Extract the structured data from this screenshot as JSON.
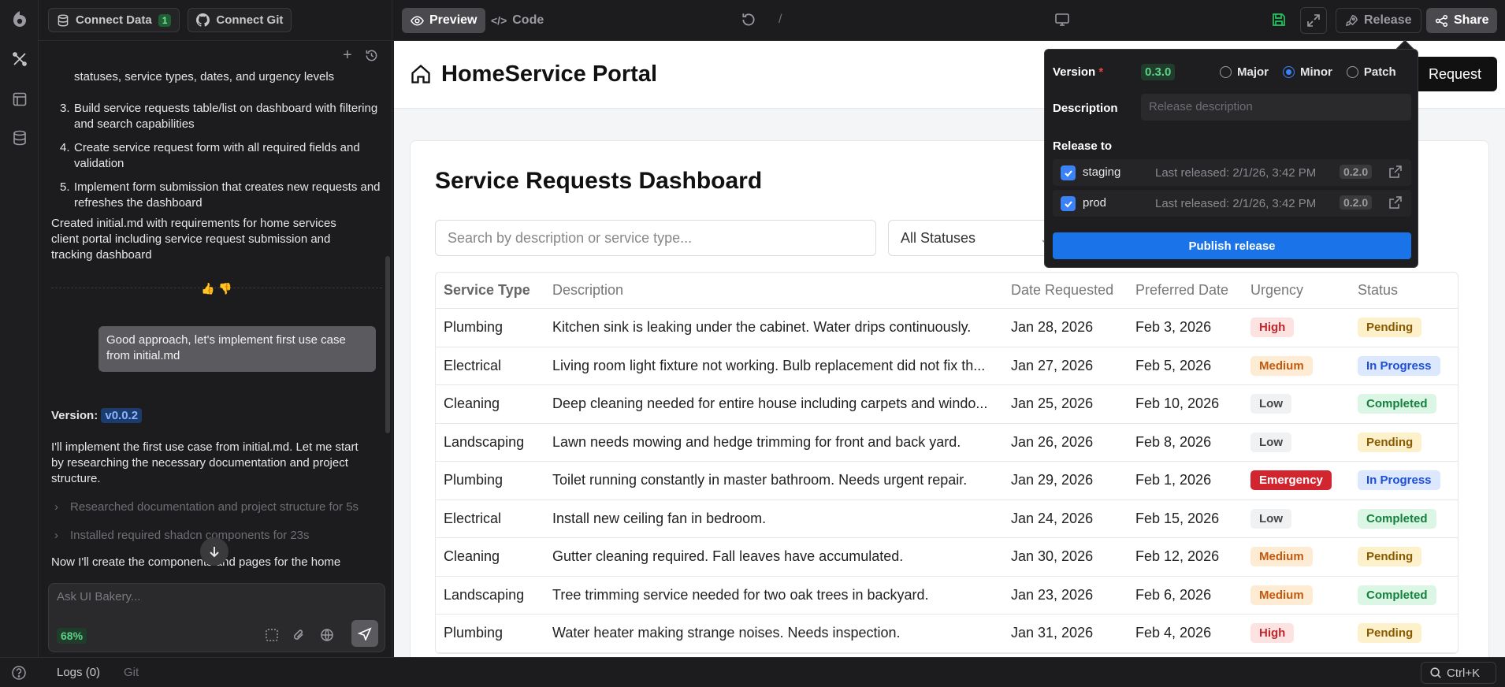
{
  "topbar": {
    "connect_data": "Connect Data",
    "connect_data_count": "1",
    "connect_git": "Connect Git",
    "preview_tab": "Preview",
    "code_tab": "Code",
    "path": "/",
    "release": "Release",
    "share": "Share"
  },
  "chat": {
    "steps": [
      {
        "num": "",
        "text": "statuses, service types, dates, and urgency levels"
      },
      {
        "num": "3.",
        "text": "Build service requests table/list on dashboard with filtering and search capabilities"
      },
      {
        "num": "4.",
        "text": "Create service request form with all required fields and validation"
      },
      {
        "num": "5.",
        "text": "Implement form submission that creates new requests and refreshes the dashboard"
      }
    ],
    "created_msg": "Created initial.md with requirements for home services client portal including service request submission and tracking dashboard",
    "user_msg": "Good approach, let's implement first use case from initial.md",
    "version_label": "Version:",
    "version_value": "v0.0.2",
    "implement_msg": "I'll implement the first use case from initial.md. Let me start by researching the necessary documentation and project structure.",
    "researched": "Researched documentation and project structure for 5s",
    "installed": "Installed required shadcn components for 23s",
    "now_msg": "Now I'll create the components and pages for the home",
    "input_placeholder": "Ask UI Bakery...",
    "context_percent": "68%"
  },
  "bottombar": {
    "logs": "Logs (0)",
    "git": "Git",
    "shortcut": "Ctrl+K"
  },
  "app": {
    "title": "HomeService Portal",
    "new_request": "Request",
    "dashboard_title": "Service Requests Dashboard",
    "search_placeholder": "Search by description or service type...",
    "status_filter": "All Statuses",
    "columns": [
      "Service Type",
      "Description",
      "Date Requested",
      "Preferred Date",
      "Urgency",
      "Status"
    ],
    "rows": [
      {
        "type": "Plumbing",
        "desc": "Kitchen sink is leaking under the cabinet. Water drips continuously.",
        "requested": "Jan 28, 2026",
        "preferred": "Feb 3, 2026",
        "urgency": "High",
        "status": "Pending"
      },
      {
        "type": "Electrical",
        "desc": "Living room light fixture not working. Bulb replacement did not fix th...",
        "requested": "Jan 27, 2026",
        "preferred": "Feb 5, 2026",
        "urgency": "Medium",
        "status": "In Progress"
      },
      {
        "type": "Cleaning",
        "desc": "Deep cleaning needed for entire house including carpets and windo...",
        "requested": "Jan 25, 2026",
        "preferred": "Feb 10, 2026",
        "urgency": "Low",
        "status": "Completed"
      },
      {
        "type": "Landscaping",
        "desc": "Lawn needs mowing and hedge trimming for front and back yard.",
        "requested": "Jan 26, 2026",
        "preferred": "Feb 8, 2026",
        "urgency": "Low",
        "status": "Pending"
      },
      {
        "type": "Plumbing",
        "desc": "Toilet running constantly in master bathroom. Needs urgent repair.",
        "requested": "Jan 29, 2026",
        "preferred": "Feb 1, 2026",
        "urgency": "Emergency",
        "status": "In Progress"
      },
      {
        "type": "Electrical",
        "desc": "Install new ceiling fan in bedroom.",
        "requested": "Jan 24, 2026",
        "preferred": "Feb 15, 2026",
        "urgency": "Low",
        "status": "Completed"
      },
      {
        "type": "Cleaning",
        "desc": "Gutter cleaning required. Fall leaves have accumulated.",
        "requested": "Jan 30, 2026",
        "preferred": "Feb 12, 2026",
        "urgency": "Medium",
        "status": "Pending"
      },
      {
        "type": "Landscaping",
        "desc": "Tree trimming service needed for two oak trees in backyard.",
        "requested": "Jan 23, 2026",
        "preferred": "Feb 6, 2026",
        "urgency": "Medium",
        "status": "Completed"
      },
      {
        "type": "Plumbing",
        "desc": "Water heater making strange noises. Needs inspection.",
        "requested": "Jan 31, 2026",
        "preferred": "Feb 4, 2026",
        "urgency": "High",
        "status": "Pending"
      }
    ]
  },
  "colors": {
    "urgency": {
      "High": {
        "bg": "#fde2e2",
        "fg": "#c0262d"
      },
      "Medium": {
        "bg": "#fdebd3",
        "fg": "#c2590c"
      },
      "Low": {
        "bg": "#f0f1f3",
        "fg": "#444444"
      },
      "Emergency": {
        "bg": "#d1262f",
        "fg": "#ffffff"
      }
    },
    "status": {
      "Pending": {
        "bg": "#fdf1cc",
        "fg": "#8a5a00"
      },
      "In Progress": {
        "bg": "#dbe8fd",
        "fg": "#1d4ed8"
      },
      "Completed": {
        "bg": "#dcf6e6",
        "fg": "#15803d"
      }
    },
    "accent": "#3b82f6"
  },
  "release": {
    "version_label": "Version",
    "required_mark": "*",
    "version_value": "0.3.0",
    "options": [
      {
        "label": "Major",
        "selected": false
      },
      {
        "label": "Minor",
        "selected": true
      },
      {
        "label": "Patch",
        "selected": false
      }
    ],
    "description_label": "Description",
    "description_placeholder": "Release description",
    "release_to_label": "Release to",
    "targets": [
      {
        "name": "staging",
        "checked": true,
        "last_released": "Last released: 2/1/26, 3:42 PM",
        "version": "0.2.0"
      },
      {
        "name": "prod",
        "checked": true,
        "last_released": "Last released: 2/1/26, 3:42 PM",
        "version": "0.2.0"
      }
    ],
    "publish": "Publish release"
  }
}
